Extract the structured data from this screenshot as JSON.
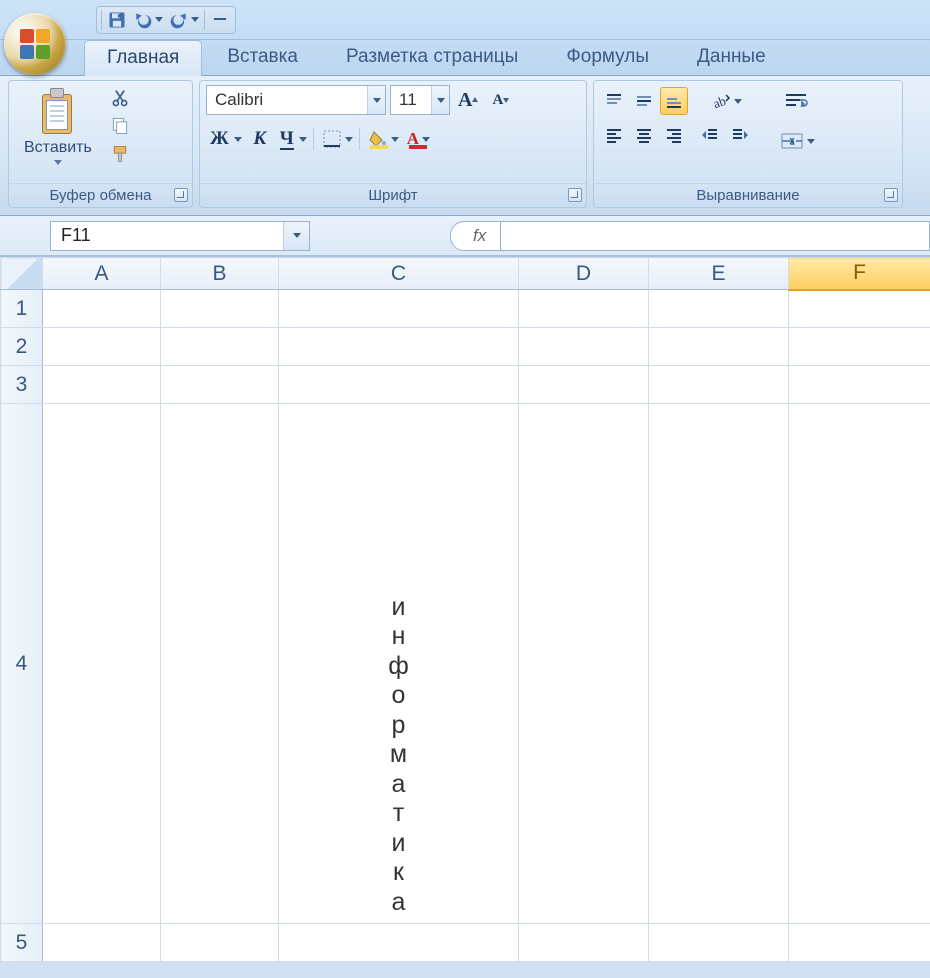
{
  "tabs": {
    "home": "Главная",
    "insert": "Вставка",
    "layout": "Разметка страницы",
    "formulas": "Формулы",
    "data": "Данные",
    "active": "home"
  },
  "groups": {
    "clipboard": "Буфер обмена",
    "font": "Шрифт",
    "alignment": "Выравнивание",
    "paste_label": "Вставить"
  },
  "font": {
    "name": "Calibri",
    "size": "11"
  },
  "namebox": "F11",
  "fx_label": "fx",
  "columns": [
    "A",
    "B",
    "C",
    "D",
    "E",
    "F"
  ],
  "rows": [
    "1",
    "2",
    "3",
    "4",
    "5"
  ],
  "active_column_index": 5,
  "tall_row_index": 3,
  "tall_cell_col_index": 2,
  "tall_cell_text": "информатика",
  "formula_value": ""
}
